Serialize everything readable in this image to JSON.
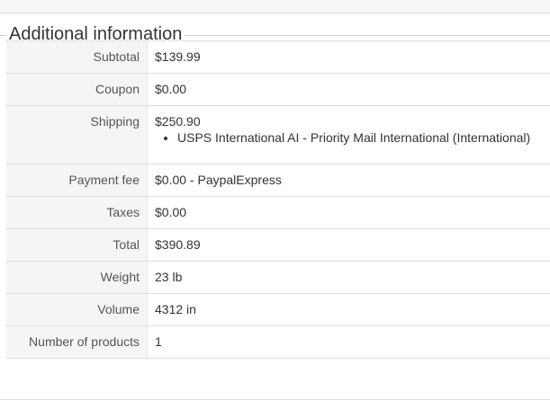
{
  "section": {
    "legend": "Additional information"
  },
  "rows": {
    "subtotal": {
      "label": "Subtotal",
      "value": "$139.99"
    },
    "coupon": {
      "label": "Coupon",
      "value": "$0.00"
    },
    "shipping": {
      "label": "Shipping",
      "value": "$250.90",
      "methods": [
        "USPS International AI - Priority Mail International (International)"
      ]
    },
    "payment_fee": {
      "label": "Payment fee",
      "value": "$0.00 - PaypalExpress"
    },
    "taxes": {
      "label": "Taxes",
      "value": "$0.00"
    },
    "total": {
      "label": "Total",
      "value": "$390.89"
    },
    "weight": {
      "label": "Weight",
      "value": "23 lb"
    },
    "volume": {
      "label": "Volume",
      "value": "4312 in"
    },
    "num_products": {
      "label": "Number of products",
      "value": "1"
    }
  }
}
